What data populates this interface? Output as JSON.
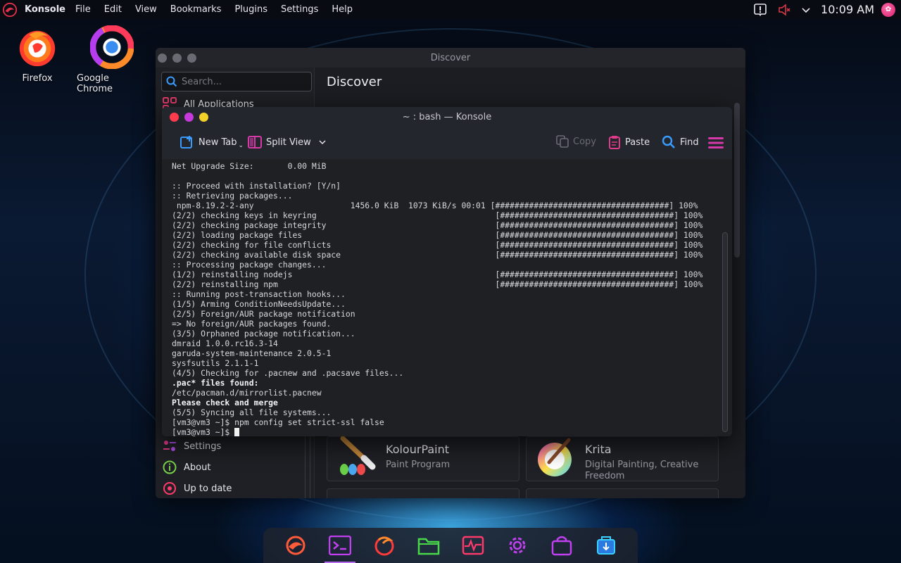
{
  "top_panel": {
    "app_name": "Konsole",
    "menu": [
      "File",
      "Edit",
      "View",
      "Bookmarks",
      "Plugins",
      "Settings",
      "Help"
    ],
    "tray": {
      "icons": [
        "notification-icon",
        "volume-muted-icon",
        "chevron-down-icon"
      ],
      "clock": "10:09 AM",
      "avatar_icon": "user-avatar-icon"
    }
  },
  "desktop": {
    "icons": [
      {
        "label": "Firefox",
        "icon": "firefox-icon"
      },
      {
        "label": "Google Chrome",
        "icon": "chrome-icon"
      }
    ]
  },
  "discover": {
    "window_title": "Discover",
    "search_placeholder": "Search...",
    "heading": "Discover",
    "sidebar_top": {
      "label": "All Applications"
    },
    "sidebar_bottom": [
      {
        "label": "Settings",
        "icon": "settings-icon"
      },
      {
        "label": "About",
        "icon": "info-icon"
      },
      {
        "label": "Up to date",
        "icon": "update-icon"
      }
    ],
    "apps": [
      {
        "name": "KolourPaint",
        "desc": "Paint Program",
        "icon": "kolourpaint-icon"
      },
      {
        "name": "Krita",
        "desc": "Digital Painting, Creative Freedom",
        "icon": "krita-icon"
      }
    ]
  },
  "konsole": {
    "window_title": "~ : bash — Konsole",
    "toolbar": {
      "new_tab": "New Tab",
      "split_view": "Split View",
      "copy": "Copy",
      "paste": "Paste",
      "find": "Find"
    },
    "terminal_lines": [
      {
        "text": "Net Upgrade Size:       0.00 MiB"
      },
      {
        "text": ""
      },
      {
        "text": ":: Proceed with installation? [Y/n]"
      },
      {
        "text": ":: Retrieving packages..."
      },
      {
        "text": " npm-8.19.2-2-any                    1456.0 KiB  1073 KiB/s 00:01 [####################################] 100%"
      },
      {
        "text": "(2/2) checking keys in keyring                                     [####################################] 100%"
      },
      {
        "text": "(2/2) checking package integrity                                   [####################################] 100%"
      },
      {
        "text": "(2/2) loading package files                                        [####################################] 100%"
      },
      {
        "text": "(2/2) checking for file conflicts                                  [####################################] 100%"
      },
      {
        "text": "(2/2) checking available disk space                                [####################################] 100%"
      },
      {
        "text": ":: Processing package changes..."
      },
      {
        "text": "(1/2) reinstalling nodejs                                          [####################################] 100%"
      },
      {
        "text": "(2/2) reinstalling npm                                             [####################################] 100%"
      },
      {
        "text": ":: Running post-transaction hooks..."
      },
      {
        "text": "(1/5) Arming ConditionNeedsUpdate..."
      },
      {
        "text": "(2/5) Foreign/AUR package notification"
      },
      {
        "text": "=> No foreign/AUR packages found."
      },
      {
        "text": "(3/5) Orphaned package notification..."
      },
      {
        "text": "dmraid 1.0.0.rc16.3-14"
      },
      {
        "text": "garuda-system-maintenance 2.0.5-1"
      },
      {
        "text": "sysfsutils 2.1.1-1"
      },
      {
        "text": "(4/5) Checking for .pacnew and .pacsave files..."
      },
      {
        "text": ".pac* files found:",
        "bold": true
      },
      {
        "text": "/etc/pacman.d/mirrorlist.pacnew"
      },
      {
        "text": "Please check and merge",
        "bold": true
      },
      {
        "text": "(5/5) Syncing all file systems..."
      },
      {
        "text": "[vm3@vm3 ~]$ npm config set strict-ssl false"
      }
    ],
    "prompt": "[vm3@vm3 ~]$ "
  },
  "dock": {
    "items": [
      "garuda-icon",
      "konsole-icon",
      "firefox-icon",
      "files-icon",
      "system-monitor-icon",
      "settings-icon",
      "discover-store-icon",
      "system-update-icon"
    ],
    "active_index": 1
  }
}
